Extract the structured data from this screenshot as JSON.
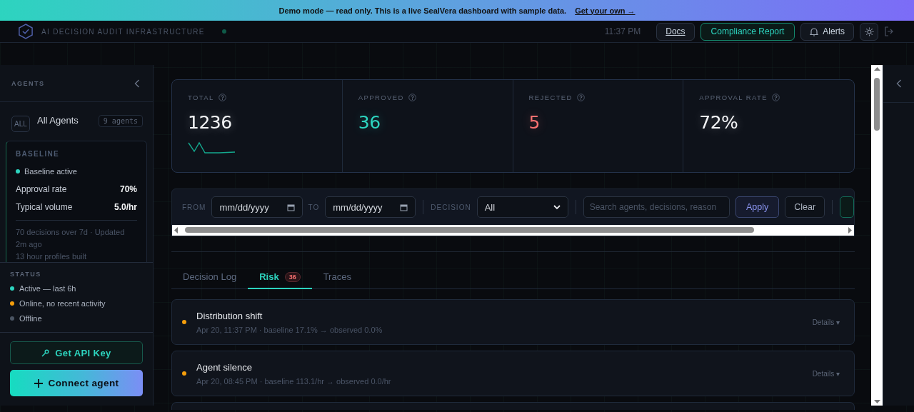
{
  "banner": {
    "message": "Demo mode — read only. This is a live SealVera dashboard with sample data.",
    "link": "Get your own →"
  },
  "header": {
    "tagline": "AI DECISION AUDIT INFRASTRUCTURE",
    "time": "11:37 PM",
    "buttons": [
      {
        "label": "Docs",
        "kind": "link"
      },
      {
        "label": "Compliance Report",
        "kind": "primary"
      },
      {
        "label": "Alerts",
        "kind": "alerts"
      },
      {
        "kind": "theme"
      },
      {
        "kind": "logout"
      }
    ]
  },
  "sidebar": {
    "title": "AGENTS",
    "all_agents": {
      "badge": "ALL",
      "label": "All Agents",
      "count": "9 agents"
    },
    "baseline": {
      "title": "BASELINE",
      "status": "Baseline active",
      "rows": [
        {
          "label": "Approval rate",
          "value": "70%"
        },
        {
          "label": "Typical volume",
          "value": "5.0/hr"
        }
      ],
      "note": "70 decisions over 7d · Updated 2m ago",
      "note_2": "13 hour profiles built"
    },
    "status": {
      "title": "STATUS",
      "items": [
        {
          "label": "Active — last 6h",
          "color": "#2dd4bf"
        },
        {
          "label": "Online, no recent activity",
          "color": "#f59e0b"
        },
        {
          "label": "Offline",
          "color": "#4b5563"
        }
      ]
    },
    "buttons": [
      {
        "label": "Get API Key",
        "kind": "outline"
      },
      {
        "label": "Connect agent",
        "kind": "gradient"
      }
    ]
  },
  "stats": [
    {
      "label": "TOTAL",
      "value": "1236",
      "color": "#f3f4f6",
      "sparkline": true
    },
    {
      "label": "APPROVED",
      "value": "36",
      "color": "#2dd4bf",
      "sparkline": false
    },
    {
      "label": "REJECTED",
      "value": "5",
      "color": "#f87171",
      "sparkline": false
    },
    {
      "label": "APPROVAL RATE",
      "value": "72%",
      "color": "#f3f4f6",
      "sparkline": false
    }
  ],
  "filters": {
    "from_label": "FROM",
    "from_value": "mm/dd/yyyy",
    "to_label": "TO",
    "to_value": "mm/dd/yyyy",
    "decision_label": "DECISION",
    "decision_value": "All",
    "search_placeholder": "Search agents, decisions, reason",
    "apply": "Apply",
    "clear": "Clear"
  },
  "tabs": [
    {
      "label": "Decision Log",
      "selected": false
    },
    {
      "label": "Risk",
      "selected": true,
      "count": "36"
    },
    {
      "label": "Traces",
      "selected": false
    }
  ],
  "risks": [
    {
      "title": "Distribution shift",
      "detail": "Apr 20, 11:37 PM · baseline 17.1% → observed 0.0%",
      "color": "#f59e0b",
      "action": "Details ▾"
    },
    {
      "title": "Agent silence",
      "detail": "Apr 20, 08:45 PM · baseline 113.1/hr → observed 0.0/hr",
      "color": "#f59e0b",
      "action": "Details ▾"
    }
  ]
}
